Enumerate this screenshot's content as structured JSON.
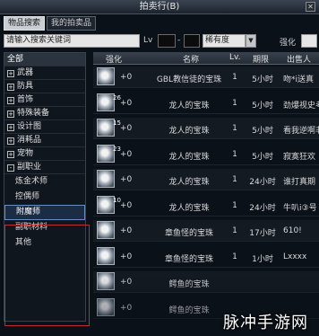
{
  "window": {
    "title": "拍卖行(B)",
    "close_glyph": "✕"
  },
  "tabs": [
    {
      "label": "物品搜索",
      "active": true
    },
    {
      "label": "我的拍卖品",
      "active": false
    }
  ],
  "search": {
    "placeholder": "请输入搜索关键词",
    "lv_label": "Lv",
    "quality_value": "稀有度",
    "dropdown_glyph": "▼",
    "enhance_label": "强化"
  },
  "sidebar": {
    "categories": [
      {
        "label": "全部",
        "toggle": "",
        "header": true
      },
      {
        "label": "武器",
        "toggle": "+"
      },
      {
        "label": "防具",
        "toggle": "+"
      },
      {
        "label": "首饰",
        "toggle": "+"
      },
      {
        "label": "特殊装备",
        "toggle": "+"
      },
      {
        "label": "设计图",
        "toggle": "+"
      },
      {
        "label": "消耗品",
        "toggle": "+"
      },
      {
        "label": "宠物",
        "toggle": "+"
      },
      {
        "label": "副职业",
        "toggle": "-"
      }
    ],
    "subcategories": [
      {
        "label": "炼金术师",
        "selected": false
      },
      {
        "label": "控偶师",
        "selected": false
      },
      {
        "label": "附魔师",
        "selected": true
      },
      {
        "label": "副职材料",
        "selected": false
      },
      {
        "label": "其他",
        "selected": false
      }
    ]
  },
  "table": {
    "headers": {
      "enhance": "强化",
      "name": "名称",
      "lv": "Lv.",
      "time": "期限",
      "seller": "出售人"
    },
    "rows": [
      {
        "qty": "",
        "enhance": "+0",
        "name": "GBL教信徒的宝珠",
        "lv": "1",
        "time": "5小时",
        "seller": "吻*i送真"
      },
      {
        "qty": "26",
        "enhance": "+0",
        "name": "龙人的宝珠",
        "lv": "1",
        "time": "5小时",
        "seller": "劲爆视史考"
      },
      {
        "qty": "15",
        "enhance": "+0",
        "name": "龙人的宝珠",
        "lv": "1",
        "time": "5小时",
        "seller": "看我逆啊非"
      },
      {
        "qty": "23",
        "enhance": "+0",
        "name": "龙人的宝珠",
        "lv": "1",
        "time": "5小时",
        "seller": "寂寞狂欢"
      },
      {
        "qty": "",
        "enhance": "+0",
        "name": "龙人的宝珠",
        "lv": "1",
        "time": "24小时",
        "seller": "谁打真期"
      },
      {
        "qty": "10",
        "enhance": "+0",
        "name": "龙人的宝珠",
        "lv": "1",
        "time": "24小时",
        "seller": "牛叭i③号"
      },
      {
        "qty": "",
        "enhance": "+0",
        "name": "章鱼怪的宝珠",
        "lv": "1",
        "time": "17小时",
        "seller": "610!"
      },
      {
        "qty": "",
        "enhance": "+0",
        "name": "章鱼怪的宝珠",
        "lv": "1",
        "time": "1小时",
        "seller": "Lxxxx"
      },
      {
        "qty": "",
        "enhance": "+0",
        "name": "鳄鱼的宝珠",
        "lv": "",
        "time": "",
        "seller": ""
      },
      {
        "qty": "",
        "enhance": "+0",
        "name": "鳄鱼的宝珠",
        "lv": "",
        "time": "",
        "seller": ""
      }
    ]
  },
  "watermark": "脉冲手游网",
  "colors": {
    "header_bg": "#2b333e",
    "selected_border": "#6c8cc0",
    "frame_red": "#b8302f"
  }
}
